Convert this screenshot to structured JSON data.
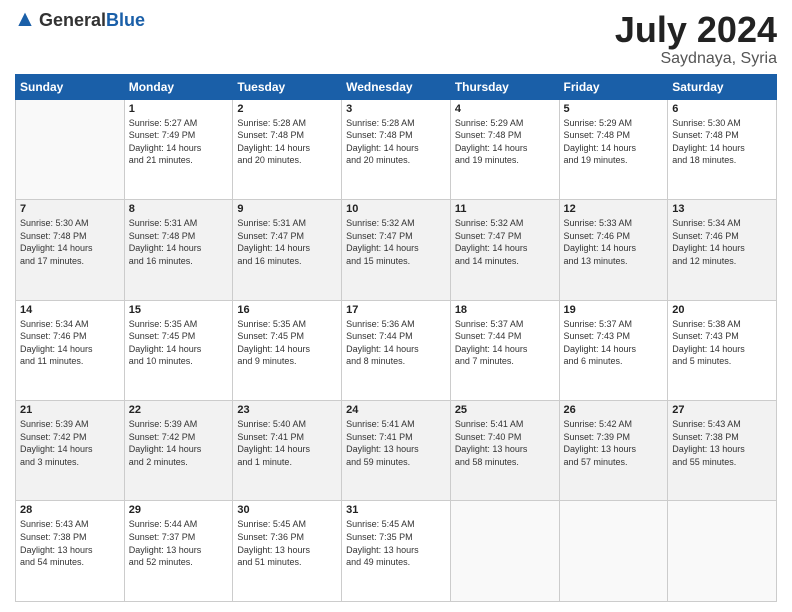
{
  "logo": {
    "general": "General",
    "blue": "Blue"
  },
  "title": {
    "month_year": "July 2024",
    "location": "Saydnaya, Syria"
  },
  "header_days": [
    "Sunday",
    "Monday",
    "Tuesday",
    "Wednesday",
    "Thursday",
    "Friday",
    "Saturday"
  ],
  "weeks": [
    {
      "alt": false,
      "days": [
        {
          "date": "",
          "info": ""
        },
        {
          "date": "1",
          "info": "Sunrise: 5:27 AM\nSunset: 7:49 PM\nDaylight: 14 hours\nand 21 minutes."
        },
        {
          "date": "2",
          "info": "Sunrise: 5:28 AM\nSunset: 7:48 PM\nDaylight: 14 hours\nand 20 minutes."
        },
        {
          "date": "3",
          "info": "Sunrise: 5:28 AM\nSunset: 7:48 PM\nDaylight: 14 hours\nand 20 minutes."
        },
        {
          "date": "4",
          "info": "Sunrise: 5:29 AM\nSunset: 7:48 PM\nDaylight: 14 hours\nand 19 minutes."
        },
        {
          "date": "5",
          "info": "Sunrise: 5:29 AM\nSunset: 7:48 PM\nDaylight: 14 hours\nand 19 minutes."
        },
        {
          "date": "6",
          "info": "Sunrise: 5:30 AM\nSunset: 7:48 PM\nDaylight: 14 hours\nand 18 minutes."
        }
      ]
    },
    {
      "alt": true,
      "days": [
        {
          "date": "7",
          "info": "Sunrise: 5:30 AM\nSunset: 7:48 PM\nDaylight: 14 hours\nand 17 minutes."
        },
        {
          "date": "8",
          "info": "Sunrise: 5:31 AM\nSunset: 7:48 PM\nDaylight: 14 hours\nand 16 minutes."
        },
        {
          "date": "9",
          "info": "Sunrise: 5:31 AM\nSunset: 7:47 PM\nDaylight: 14 hours\nand 16 minutes."
        },
        {
          "date": "10",
          "info": "Sunrise: 5:32 AM\nSunset: 7:47 PM\nDaylight: 14 hours\nand 15 minutes."
        },
        {
          "date": "11",
          "info": "Sunrise: 5:32 AM\nSunset: 7:47 PM\nDaylight: 14 hours\nand 14 minutes."
        },
        {
          "date": "12",
          "info": "Sunrise: 5:33 AM\nSunset: 7:46 PM\nDaylight: 14 hours\nand 13 minutes."
        },
        {
          "date": "13",
          "info": "Sunrise: 5:34 AM\nSunset: 7:46 PM\nDaylight: 14 hours\nand 12 minutes."
        }
      ]
    },
    {
      "alt": false,
      "days": [
        {
          "date": "14",
          "info": "Sunrise: 5:34 AM\nSunset: 7:46 PM\nDaylight: 14 hours\nand 11 minutes."
        },
        {
          "date": "15",
          "info": "Sunrise: 5:35 AM\nSunset: 7:45 PM\nDaylight: 14 hours\nand 10 minutes."
        },
        {
          "date": "16",
          "info": "Sunrise: 5:35 AM\nSunset: 7:45 PM\nDaylight: 14 hours\nand 9 minutes."
        },
        {
          "date": "17",
          "info": "Sunrise: 5:36 AM\nSunset: 7:44 PM\nDaylight: 14 hours\nand 8 minutes."
        },
        {
          "date": "18",
          "info": "Sunrise: 5:37 AM\nSunset: 7:44 PM\nDaylight: 14 hours\nand 7 minutes."
        },
        {
          "date": "19",
          "info": "Sunrise: 5:37 AM\nSunset: 7:43 PM\nDaylight: 14 hours\nand 6 minutes."
        },
        {
          "date": "20",
          "info": "Sunrise: 5:38 AM\nSunset: 7:43 PM\nDaylight: 14 hours\nand 5 minutes."
        }
      ]
    },
    {
      "alt": true,
      "days": [
        {
          "date": "21",
          "info": "Sunrise: 5:39 AM\nSunset: 7:42 PM\nDaylight: 14 hours\nand 3 minutes."
        },
        {
          "date": "22",
          "info": "Sunrise: 5:39 AM\nSunset: 7:42 PM\nDaylight: 14 hours\nand 2 minutes."
        },
        {
          "date": "23",
          "info": "Sunrise: 5:40 AM\nSunset: 7:41 PM\nDaylight: 14 hours\nand 1 minute."
        },
        {
          "date": "24",
          "info": "Sunrise: 5:41 AM\nSunset: 7:41 PM\nDaylight: 13 hours\nand 59 minutes."
        },
        {
          "date": "25",
          "info": "Sunrise: 5:41 AM\nSunset: 7:40 PM\nDaylight: 13 hours\nand 58 minutes."
        },
        {
          "date": "26",
          "info": "Sunrise: 5:42 AM\nSunset: 7:39 PM\nDaylight: 13 hours\nand 57 minutes."
        },
        {
          "date": "27",
          "info": "Sunrise: 5:43 AM\nSunset: 7:38 PM\nDaylight: 13 hours\nand 55 minutes."
        }
      ]
    },
    {
      "alt": false,
      "days": [
        {
          "date": "28",
          "info": "Sunrise: 5:43 AM\nSunset: 7:38 PM\nDaylight: 13 hours\nand 54 minutes."
        },
        {
          "date": "29",
          "info": "Sunrise: 5:44 AM\nSunset: 7:37 PM\nDaylight: 13 hours\nand 52 minutes."
        },
        {
          "date": "30",
          "info": "Sunrise: 5:45 AM\nSunset: 7:36 PM\nDaylight: 13 hours\nand 51 minutes."
        },
        {
          "date": "31",
          "info": "Sunrise: 5:45 AM\nSunset: 7:35 PM\nDaylight: 13 hours\nand 49 minutes."
        },
        {
          "date": "",
          "info": ""
        },
        {
          "date": "",
          "info": ""
        },
        {
          "date": "",
          "info": ""
        }
      ]
    }
  ]
}
